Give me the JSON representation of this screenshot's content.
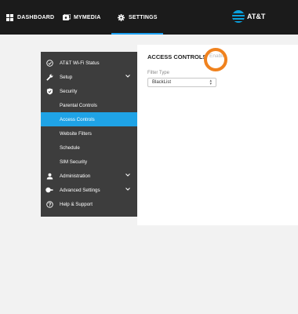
{
  "nav": {
    "dashboard": "DASHBOARD",
    "mymedia": "MYMEDIA",
    "settings": "SETTINGS",
    "brand": "AT&T"
  },
  "menu": {
    "items": [
      {
        "label": "AT&T Wi-Fi Status",
        "icon": "check-circle-icon"
      },
      {
        "label": "Setup",
        "icon": "wrench-icon"
      },
      {
        "label": "Security",
        "icon": "shield-icon"
      },
      {
        "label": "Parental Controls"
      },
      {
        "label": "Access Controls"
      },
      {
        "label": "Website Filters"
      },
      {
        "label": "Schedule"
      },
      {
        "label": "SIM Security"
      },
      {
        "label": "Administration",
        "icon": "user-icon"
      },
      {
        "label": "Advanced Settings",
        "icon": "toggle-icon"
      },
      {
        "label": "Help & Support",
        "icon": "question-circle-icon"
      }
    ],
    "active_index": 4
  },
  "main": {
    "title": "ACCESS CONTROLS",
    "enable_label": "Enable",
    "filter_type_label": "Filter Type",
    "filter_type_value": "BlackList"
  },
  "colors": {
    "topbar": "#1b1b1b",
    "menu_bg": "#3d3d3d",
    "active": "#1fa3e6",
    "highlight": "#f0821e"
  }
}
